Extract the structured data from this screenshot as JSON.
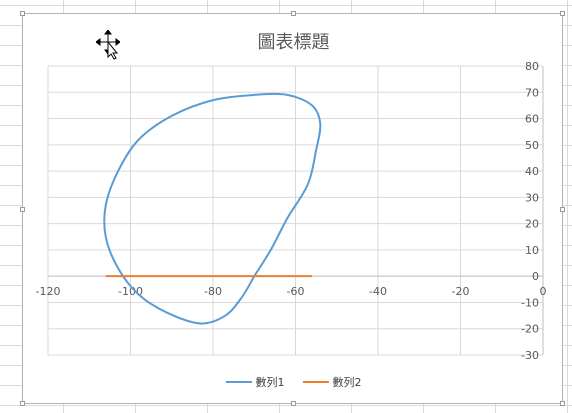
{
  "chart_data": {
    "type": "scatter",
    "title": "圖表標題",
    "xlim": [
      -120,
      0
    ],
    "ylim": [
      -30,
      80
    ],
    "x_ticks": [
      -120,
      -100,
      -80,
      -60,
      -40,
      -20,
      0
    ],
    "y_ticks": [
      -30,
      -20,
      -10,
      0,
      10,
      20,
      30,
      40,
      50,
      60,
      70,
      80
    ],
    "grid": true,
    "legend_position": "bottom",
    "series": [
      {
        "name": "數列1",
        "color": "#5b9bd5",
        "smooth": true,
        "points": [
          [
            -70,
            0
          ],
          [
            -66,
            10
          ],
          [
            -62,
            22
          ],
          [
            -57,
            35
          ],
          [
            -55,
            48
          ],
          [
            -54,
            58
          ],
          [
            -56,
            65
          ],
          [
            -62,
            69
          ],
          [
            -70,
            69
          ],
          [
            -80,
            67
          ],
          [
            -90,
            61
          ],
          [
            -98,
            52
          ],
          [
            -103,
            40
          ],
          [
            -106,
            27
          ],
          [
            -106,
            15
          ],
          [
            -103,
            3
          ],
          [
            -98,
            -7
          ],
          [
            -91,
            -14
          ],
          [
            -83,
            -18
          ],
          [
            -77,
            -15
          ],
          [
            -73,
            -8
          ],
          [
            -70,
            0
          ]
        ]
      },
      {
        "name": "數列2",
        "color": "#ed7d31",
        "smooth": false,
        "points": [
          [
            -106,
            0
          ],
          [
            -56,
            0
          ]
        ]
      }
    ]
  }
}
